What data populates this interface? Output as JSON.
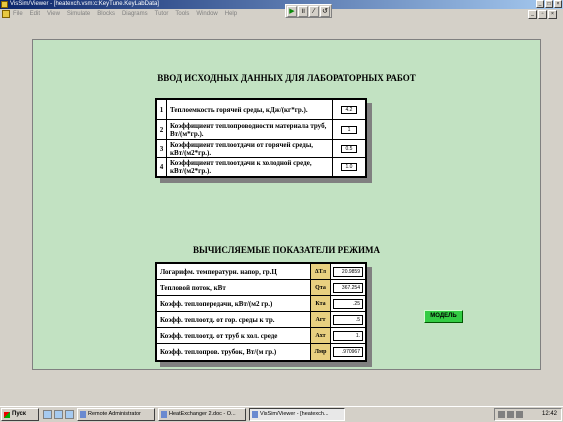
{
  "window": {
    "title": "VisSim/Viewer - [heatexch.vsm:c:KeyTune.KeyLabData]"
  },
  "menu": [
    "File",
    "Edit",
    "View",
    "Simulate",
    "Blocks",
    "Diagrams",
    "Tutor",
    "Tools",
    "Window",
    "Help"
  ],
  "page": {
    "input_heading": "ВВОД ИСХОДНЫХ ДАННЫХ ДЛЯ ЛАБОРАТОРНЫХ РАБОТ",
    "inputs": [
      {
        "num": "1",
        "label": "Теплоемкость горячей среды, кДж/(кг*гр.).",
        "value": "4.2"
      },
      {
        "num": "2",
        "label": "Коэффициент теплопроводности материала труб, Вт/(м*гр.).",
        "value": "1"
      },
      {
        "num": "3",
        "label": "Коэффициент теплоотдачи от горячей среды, кВт/(м2*гр.).",
        "value": "0.5"
      },
      {
        "num": "4",
        "label": "Коэффициент теплоотдачи к холодной среде, кВт/(м2*гр.).",
        "value": "1.0"
      }
    ],
    "output_heading": "ВЫЧИСЛЯЕМЫЕ ПОКАЗАТЕЛИ РЕЖИМА",
    "outputs": [
      {
        "label": "Логарифм. температурн. напор, гр.Ц",
        "symbol": "ΔTл",
        "value": "20.9859"
      },
      {
        "label": "Тепловой поток, кВт",
        "symbol": "Qта",
        "value": "367.254"
      },
      {
        "label": "Коэфф. теплопередачи, кВт/(м2 гр.)",
        "symbol": "Кта",
        "value": ".25"
      },
      {
        "label": "Коэфф. теплоотд. от гор. среды к тр.",
        "symbol": "Агт",
        "value": ".5"
      },
      {
        "label": "Коэфф. теплоотд. от труб к хол. среде",
        "symbol": "Ахт",
        "value": "1."
      },
      {
        "label": "Коэфф. теплопров. трубок, Вт/(м гр.)",
        "symbol": "Лмр",
        "value": ".970967"
      }
    ],
    "model_button": "МОДЕЛЬ"
  },
  "taskbar": {
    "start": "Пуск",
    "tasks": [
      {
        "label": "Remote Administrator",
        "active": false
      },
      {
        "label": "HeatExchanger 2.doc - O...",
        "active": false
      },
      {
        "label": "VisSim/Viewer - [heatexch...",
        "active": true
      }
    ],
    "clock": "12:42"
  }
}
